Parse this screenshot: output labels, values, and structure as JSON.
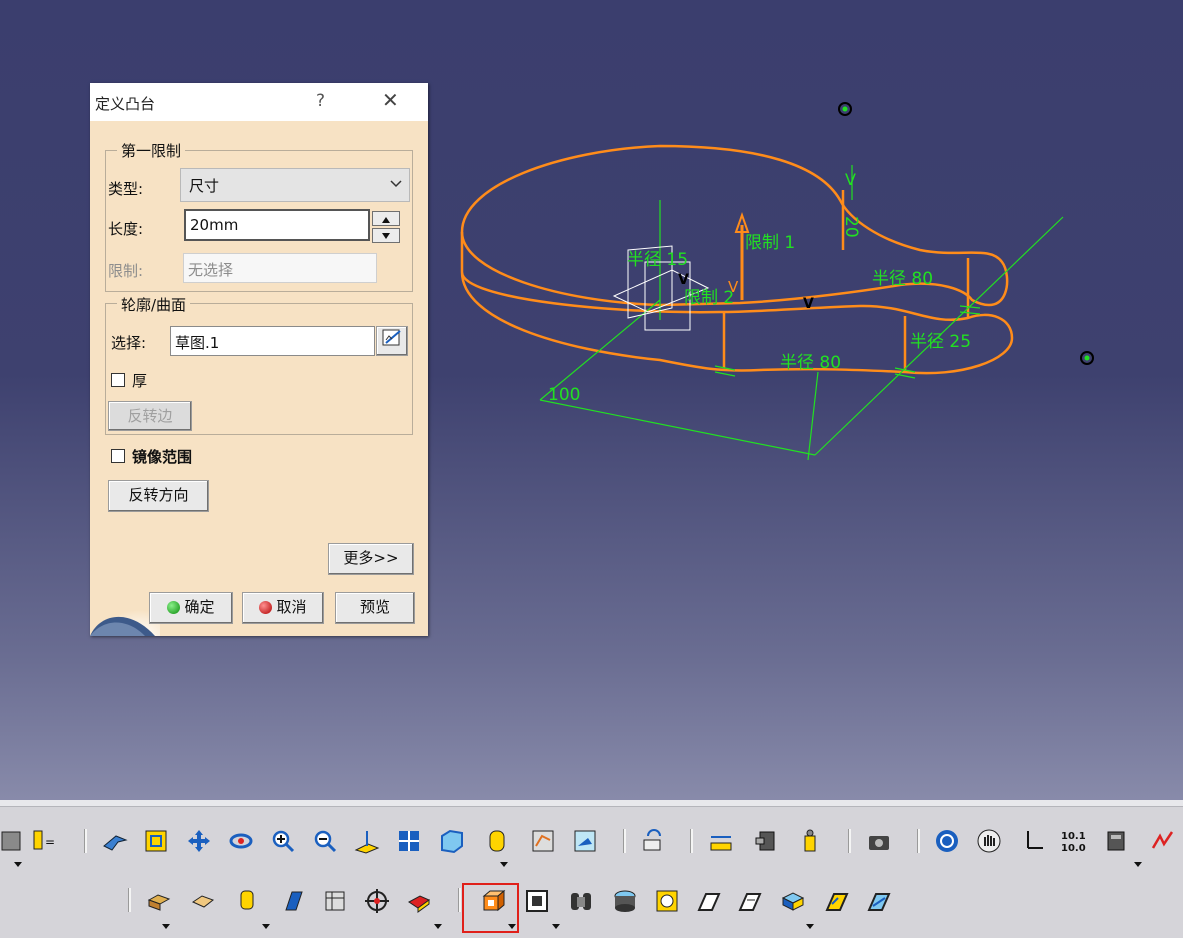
{
  "dialog": {
    "title": "定义凸台",
    "help": "?",
    "close": "✕",
    "first_limit": {
      "group_label": "第一限制",
      "type_label": "类型:",
      "type_value": "尺寸",
      "length_label": "长度:",
      "length_value": "20mm",
      "limit_label": "限制:",
      "limit_value": "无选择"
    },
    "profile": {
      "group_label": "轮廓/曲面",
      "select_label": "选择:",
      "select_value": "草图.1",
      "thick_label": "厚",
      "reverse_side_label": "反转边"
    },
    "mirror_label": "镜像范围",
    "reverse_direction_label": "反转方向",
    "more_label": "更多>>",
    "ok_label": "确定",
    "cancel_label": "取消",
    "preview_label": "预览"
  },
  "viewport": {
    "dimensions": {
      "radius_15": "半径 15",
      "limit_1": "限制 1",
      "limit_2": "限制 2",
      "radius_80_top": "半径 80",
      "radius_25": "半径 25",
      "radius_80_bottom": "半径 80",
      "length_100": "100",
      "length_20": "20"
    },
    "marker_labels": [
      "V",
      "V",
      "V",
      "V"
    ],
    "colors": {
      "geometry": "#ff8c1a",
      "dimension": "#22e022",
      "background_top": "#3b3e6e",
      "background_bottom": "#a5a7c1"
    }
  },
  "toolbar": {
    "row1_icons": [
      "save-icon",
      "specification-tree-icon",
      "fly-mode-icon",
      "fit-all-icon",
      "pan-icon",
      "rotate-icon",
      "zoom-in-icon",
      "zoom-out-icon",
      "normal-view-icon",
      "multi-view-icon",
      "isometric-view-icon",
      "view-mode-icon",
      "hide-show-icon",
      "swap-visible-icon",
      "update-icon",
      "measure-between-icon",
      "measure-item-icon",
      "measure-inertia-icon",
      "capture-icon",
      "catalog-icon",
      "hand-icon",
      "axis-system-icon",
      "numeric-icon",
      "apply-material-icon",
      "knowledge-icon"
    ],
    "row2_icons": [
      "pad-icon",
      "pocket-icon",
      "shaft-icon",
      "groove-icon",
      "hole-icon",
      "rib-icon",
      "slot-icon",
      "stiffener-icon",
      "solid-combine-icon",
      "multi-sections-icon",
      "removed-multi-sections-icon",
      "draft-icon",
      "shell-icon",
      "thickness-icon",
      "thread-icon",
      "remove-face-icon",
      "replace-face-icon"
    ],
    "highlight_color": "#e0201a",
    "highlight_icon": "pad-icon"
  }
}
